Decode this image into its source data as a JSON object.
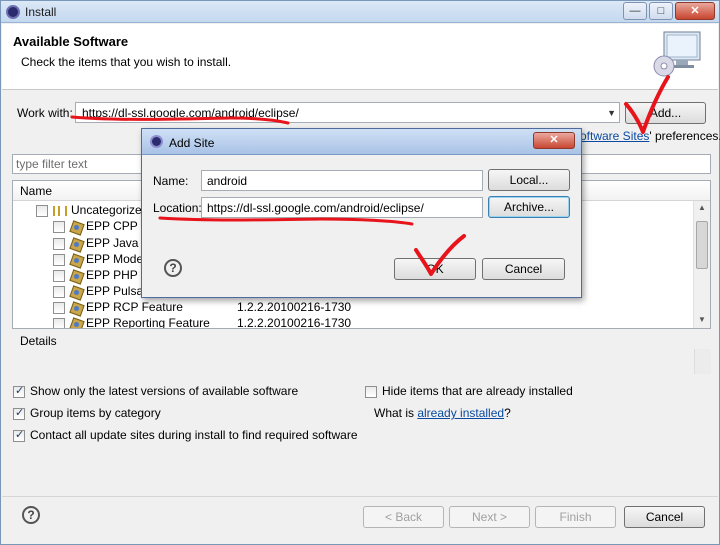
{
  "window": {
    "title": "Install",
    "controls": [
      "minimize",
      "maximize",
      "close"
    ]
  },
  "header": {
    "title": "Available Software",
    "subtitle": "Check the items that you wish to install."
  },
  "work_with": {
    "label": "Work with:",
    "value": "https://dl-ssl.google.com/android/eclipse/",
    "add_button": "Add..."
  },
  "prefs_link": {
    "link_text": "oftware Sites",
    "suffix": "' preferences."
  },
  "filter": {
    "placeholder": "type filter text"
  },
  "tree": {
    "column": "Name",
    "group": "Uncategorized",
    "items": [
      {
        "name": "EPP CPP Fe",
        "version": ""
      },
      {
        "name": "EPP Java Pa",
        "version": ""
      },
      {
        "name": "EPP Modelli",
        "version": ""
      },
      {
        "name": "EPP PHP Fe",
        "version": ""
      },
      {
        "name": "EPP Pulsar",
        "version": ""
      },
      {
        "name": "EPP RCP Feature",
        "version": "1.2.2.20100216-1730"
      },
      {
        "name": "EPP Reporting Feature",
        "version": "1.2.2.20100216-1730"
      }
    ]
  },
  "details": {
    "label": "Details"
  },
  "options": {
    "show_latest": "Show only the latest versions of available software",
    "group_by_category": "Group items by category",
    "contact_sites": "Contact all update sites during install to find required software",
    "hide_installed": "Hide items that are already installed",
    "what_is_prefix": "What is ",
    "already_installed_link": "already installed",
    "what_is_suffix": "?"
  },
  "footer": {
    "back": "< Back",
    "next": "Next >",
    "finish": "Finish",
    "cancel": "Cancel"
  },
  "dialog": {
    "title": "Add Site",
    "name_label": "Name:",
    "name_value": "android",
    "local_button": "Local...",
    "location_label": "Location:",
    "location_value": "https://dl-ssl.google.com/android/eclipse/",
    "archive_button": "Archive...",
    "ok_button": "OK",
    "cancel_button": "Cancel"
  },
  "colors": {
    "annotation_red": "#e8141c",
    "link_blue": "#0b4aa0"
  }
}
